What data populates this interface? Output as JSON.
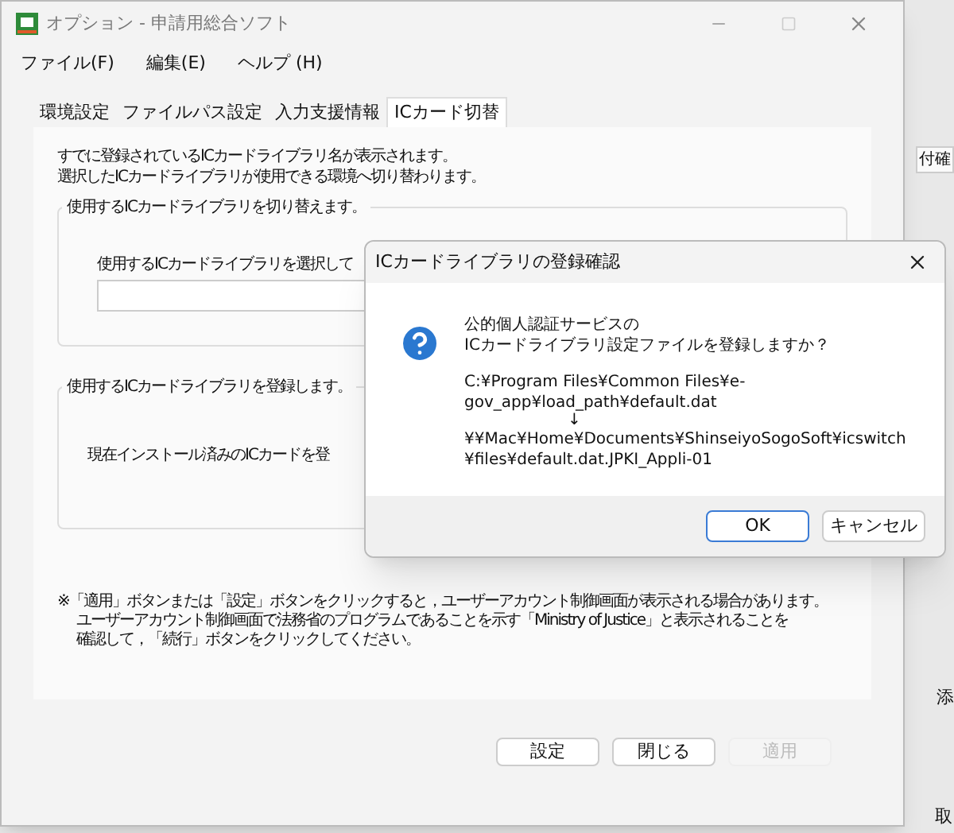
{
  "window": {
    "title": "オプション - 申請用総合ソフト"
  },
  "menu": [
    "ファイル(F)",
    "編集(E)",
    "ヘルプ (H)"
  ],
  "tabs": [
    {
      "label": "環境設定",
      "selected": false
    },
    {
      "label": "ファイルパス設定",
      "selected": false
    },
    {
      "label": "入力支援情報",
      "selected": false
    },
    {
      "label": "ICカード切替",
      "selected": true
    }
  ],
  "intro": [
    "すでに登録されているICカードライブラリ名が表示されます。",
    "選択したICカードライブラリが使用できる環境へ切り替わります。"
  ],
  "switch_group": {
    "legend": "使用するICカードライブラリを切り替えます。",
    "label": "使用するICカードライブラリを選択して"
  },
  "register_group": {
    "legend": "使用するICカードライブラリを登録します。",
    "label": "現在インストール済みのICカードを登"
  },
  "note": [
    "※「適用」ボタンまたは「設定」ボタンをクリックすると，ユーザーアカウント制御画面が表示される場合があります。",
    "ユーザーアカウント制御画面で法務省のプログラムであることを示す「Ministry of Justice」と表示されることを",
    "確認して，「続行」ボタンをクリックしてください。"
  ],
  "buttons": [
    {
      "label": "設定",
      "disabled": false
    },
    {
      "label": "閉じる",
      "disabled": false
    },
    {
      "label": "適用",
      "disabled": true
    }
  ],
  "dialog": {
    "title": "ICカードライブラリの登録確認",
    "question": [
      "公的個人認証サービスの",
      "ICカードライブラリ設定ファイルを登録しますか？"
    ],
    "source": "C:¥Program Files¥Common Files¥e-gov_app¥load_path¥default.dat",
    "arrow": "↓",
    "target": "¥¥Mac¥Home¥Documents¥ShinseiyoSogoSoft¥icswitch¥files¥default.dat.JPKI_Appli-01",
    "buttons": [
      {
        "label": "OK",
        "default": true
      },
      {
        "label": "キャンセル",
        "default": false
      }
    ]
  },
  "background_window": {
    "button": "付確",
    "label_1": "添",
    "label_2": "取"
  }
}
